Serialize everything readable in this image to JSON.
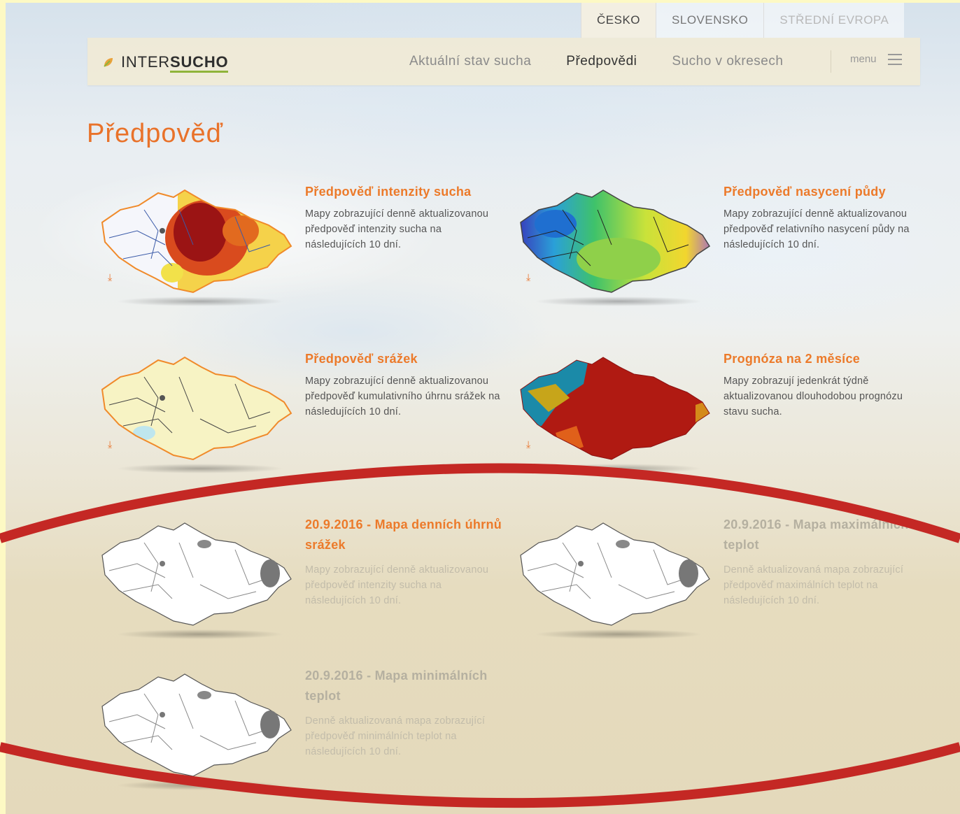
{
  "region_tabs": [
    {
      "label": "ČESKO",
      "state": "active"
    },
    {
      "label": "SLOVENSKO",
      "state": "normal"
    },
    {
      "label": "STŘEDNÍ EVROPA",
      "state": "muted"
    }
  ],
  "logo": {
    "prefix": "INTER",
    "bold": "SUCHO",
    "icon": "leaf-icon"
  },
  "nav": {
    "items": [
      "Aktuální stav sucha",
      "Předpovědi",
      "Sucho v okresech"
    ],
    "active": "Předpovědi",
    "menu_label": "menu"
  },
  "page_title": "Předpověď",
  "cards": [
    {
      "title": "Předpověď intenzity sucha",
      "description": "Mapy zobrazující denně aktualizovanou předpověď intenzity sucha na následujících 10 dní.",
      "map_style": "intensity"
    },
    {
      "title": "Předpověď nasycení půdy",
      "description": "Mapy zobrazující denně aktualizovanou předpověď relativního nasycení půdy na následujících 10 dní.",
      "map_style": "saturation"
    },
    {
      "title": "Předpověď srážek",
      "description": "Mapy zobrazující denně aktualizovanou předpověď kumulativního úhrnu srážek na následujících 10 dní.",
      "map_style": "precipitation"
    },
    {
      "title": "Prognóza na 2 měsíce",
      "description": "Mapy zobrazují jedenkrát týdně aktualizovanou dlouhodobou prognózu stavu sucha.",
      "map_style": "prognosis"
    },
    {
      "title": "20.9.2016 - Mapa denních úhrnů srážek",
      "description": "Mapy zobrazující denně aktualizovanou předpověď intenzity sucha na následujících 10 dní.",
      "map_style": "blank"
    },
    {
      "title": "20.9.2016 - Mapa maximálních teplot",
      "description": "Denně aktualizovaná mapa zobrazující předpověď maximálních teplot na následujících 10 dní.",
      "map_style": "blank"
    },
    {
      "title": "20.9.2016 - Mapa minimálních teplot",
      "description": "Denně aktualizovaná mapa zobrazující předpověď minimálních teplot na následujících 10 dní.",
      "map_style": "blank"
    }
  ],
  "colors": {
    "accent": "#ec7a2a",
    "annotation": "#c42824",
    "logo_underline": "#8fb43a"
  }
}
